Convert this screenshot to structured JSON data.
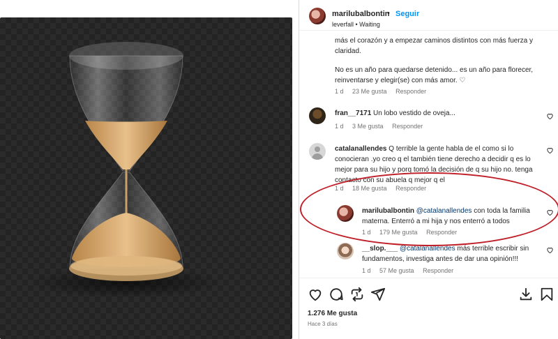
{
  "post": {
    "author": "marilubalbontin",
    "separator": "•",
    "follow_label": "Seguir",
    "audio": "leverfall • Waiting",
    "caption_lines": [
      "más el corazón y a empezar caminos distintos con más fuerza y claridad.",
      "No es un año para quedarse detenido... es un año para florecer, reinventarse y elegir(se) con más amor. ♡"
    ],
    "caption_meta": {
      "age": "1 d",
      "likes": "23 Me gusta",
      "reply": "Responder"
    }
  },
  "comments": [
    {
      "user": "fran__7171",
      "text": "Un lobo vestido de oveja...",
      "age": "1 d",
      "likes": "3 Me gusta",
      "reply": "Responder"
    },
    {
      "user": "catalanallendes",
      "text": "Q terrible la gente habla de el como si lo conocieran .yo creo q el también tiene derecho a decidir q es lo mejor para su hijo y porq tomó la decisión de q su hijo no. tenga contacto con su abuela q mejor q el",
      "age": "1 d",
      "likes": "18 Me gusta",
      "reply": "Responder"
    },
    {
      "user": "marilubalbontin",
      "mention": "@catalanallendes",
      "text": "con toda la familia materna. Enterró a mi hija y nos enterró a todos",
      "age": "1 d",
      "likes": "179 Me gusta",
      "reply": "Responder"
    },
    {
      "user": "__slop.___",
      "mention": "@catalanallendes",
      "text": "más terrible escribir sin fundamentos, investiga antes de dar una opinión!!!",
      "age": "1 d",
      "likes": "57 Me gusta",
      "reply": "Responder"
    }
  ],
  "footer": {
    "likes": "1.276 Me gusta",
    "time": "Hace 3 días"
  },
  "icons": {
    "like": "heart-icon",
    "comment": "comment-icon",
    "repost": "repost-icon",
    "share": "share-icon",
    "download": "download-icon",
    "save": "bookmark-icon"
  },
  "colors": {
    "accent": "#0095f6",
    "annotation_circle": "#c0202a",
    "mention": "#00376b"
  }
}
